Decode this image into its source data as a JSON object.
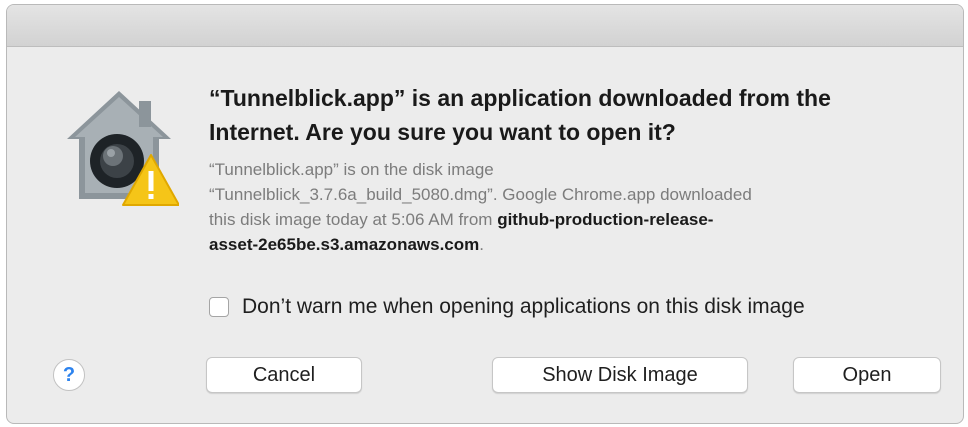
{
  "dialog": {
    "heading_line1": "“Tunnelblick.app” is an application downloaded from the",
    "heading_line2": "Internet. Are you sure you want to open it?",
    "info_line1": "“Tunnelblick.app” is on the disk image",
    "info_line2": "“Tunnelblick_3.7.6a_build_5080.dmg”. Google Chrome.app downloaded",
    "info_line3_prefix": "this disk image today at 5:06 AM from ",
    "info_line3_bold": "github-production-release-",
    "info_line4_bold": "asset-2e65be.s3.amazonaws.com",
    "info_line4_suffix": ".",
    "checkbox_label": "Don’t warn me when opening applications on this disk image",
    "checkbox_checked": false,
    "icon": "gatekeeper-warning-icon"
  },
  "buttons": {
    "help": "?",
    "cancel": "Cancel",
    "show_disk_image": "Show Disk Image",
    "open": "Open"
  },
  "colors": {
    "window_bg": "#ececec",
    "warning_yellow": "#f5c518",
    "help_blue": "#2d83ee"
  }
}
